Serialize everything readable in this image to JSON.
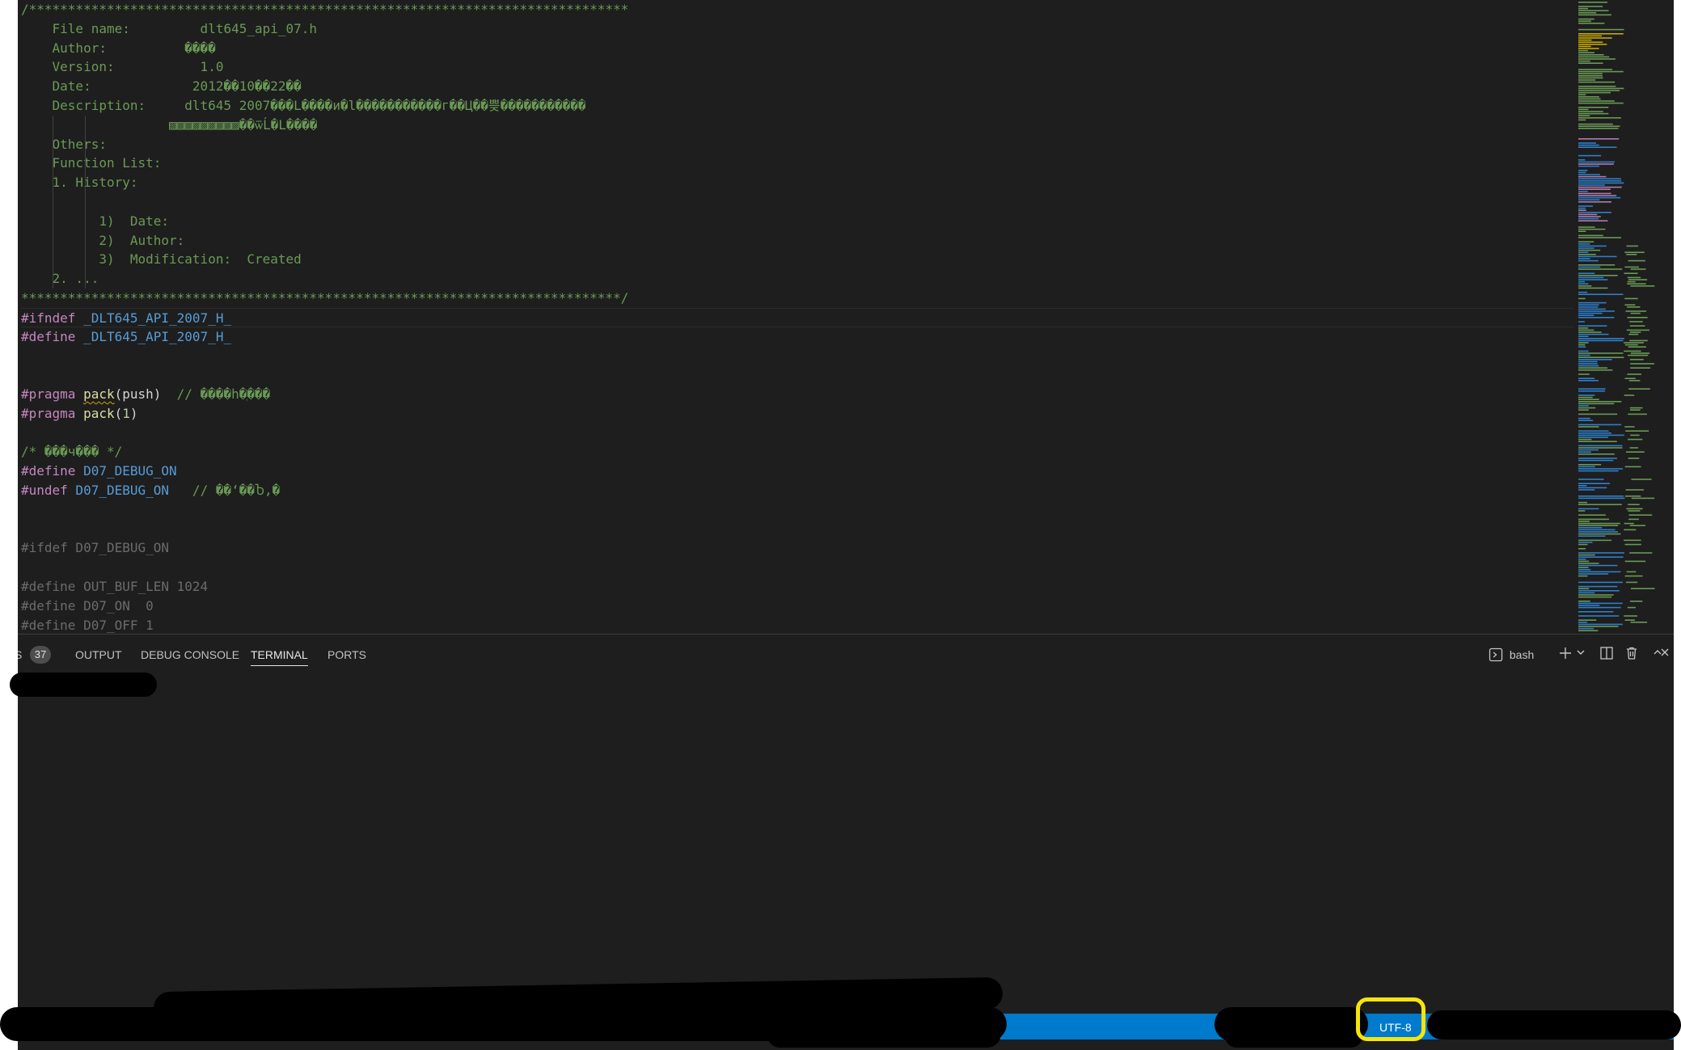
{
  "editor": {
    "lines": [
      {
        "parts": [
          {
            "cls": "c",
            "text": "/*****************************************************************************"
          }
        ]
      },
      {
        "parts": [
          {
            "cls": "c",
            "text": "    File name:         dlt645_api_07.h"
          }
        ]
      },
      {
        "parts": [
          {
            "cls": "c",
            "text": "    Author:          ����"
          }
        ]
      },
      {
        "parts": [
          {
            "cls": "c",
            "text": "    Version:           1.0"
          }
        ]
      },
      {
        "parts": [
          {
            "cls": "c",
            "text": "    Date:             2012��10��22��"
          }
        ]
      },
      {
        "parts": [
          {
            "cls": "c",
            "text": "    Description:     dlt645 2007���L����и�l�����������г��Ц��쁮�����������"
          }
        ]
      },
      {
        "parts": [
          {
            "cls": "c",
            "text": "                   ▨▨▨▨▨▨▨▨▨��ѿĹ�L����"
          }
        ]
      },
      {
        "parts": [
          {
            "cls": "c",
            "text": "    Others:"
          }
        ]
      },
      {
        "parts": [
          {
            "cls": "c",
            "text": "    Function List:"
          }
        ]
      },
      {
        "parts": [
          {
            "cls": "c",
            "text": "    1. History:"
          }
        ]
      },
      {
        "parts": [
          {
            "cls": "c",
            "text": ""
          }
        ]
      },
      {
        "parts": [
          {
            "cls": "c",
            "text": "          1)  Date:"
          }
        ]
      },
      {
        "parts": [
          {
            "cls": "c",
            "text": "          2)  Author:"
          }
        ]
      },
      {
        "parts": [
          {
            "cls": "c",
            "text": "          3)  Modification:  Created"
          }
        ]
      },
      {
        "parts": [
          {
            "cls": "c",
            "text": "    2. ..."
          }
        ]
      },
      {
        "parts": [
          {
            "cls": "c",
            "text": "*****************************************************************************/"
          }
        ]
      },
      {
        "current": true,
        "parts": [
          {
            "cls": "pp",
            "text": "#ifndef"
          },
          {
            "cls": "mac",
            "text": " _DLT645_API_2007_H_"
          }
        ]
      },
      {
        "parts": [
          {
            "cls": "pp",
            "text": "#define"
          },
          {
            "cls": "mac",
            "text": " _DLT645_API_2007_H_"
          }
        ]
      },
      {
        "parts": [
          {
            "cls": "pn",
            "text": ""
          }
        ]
      },
      {
        "parts": [
          {
            "cls": "pn",
            "text": ""
          }
        ]
      },
      {
        "parts": [
          {
            "cls": "pp",
            "text": "#pragma"
          },
          {
            "cls": "pn",
            "text": " "
          },
          {
            "cls": "fn squig",
            "text": "pack"
          },
          {
            "cls": "pn",
            "text": "(push)"
          },
          {
            "cls": "c",
            "text": "  // ����һ�ֽ���"
          }
        ]
      },
      {
        "parts": [
          {
            "cls": "pp",
            "text": "#pragma"
          },
          {
            "cls": "pn",
            "text": " "
          },
          {
            "cls": "fn",
            "text": "pack"
          },
          {
            "cls": "pn",
            "text": "("
          },
          {
            "cls": "num",
            "text": "1"
          },
          {
            "cls": "pn",
            "text": ")"
          }
        ]
      },
      {
        "parts": [
          {
            "cls": "pn",
            "text": ""
          }
        ]
      },
      {
        "parts": [
          {
            "cls": "c",
            "text": "/* ���ч��� */"
          }
        ]
      },
      {
        "parts": [
          {
            "cls": "pp",
            "text": "#define"
          },
          {
            "cls": "mac",
            "text": " D07_DEBUG_ON"
          }
        ]
      },
      {
        "parts": [
          {
            "cls": "pp",
            "text": "#undef"
          },
          {
            "cls": "mac",
            "text": " D07_DEBUG_ON"
          },
          {
            "cls": "c",
            "text": "   // ��ʻ��Ⴆ,�"
          }
        ]
      },
      {
        "parts": [
          {
            "cls": "pn",
            "text": ""
          }
        ]
      },
      {
        "parts": [
          {
            "cls": "pn",
            "text": ""
          }
        ]
      },
      {
        "parts": [
          {
            "cls": "dim",
            "text": "#ifdef D07_DEBUG_ON"
          }
        ]
      },
      {
        "parts": [
          {
            "cls": "pn",
            "text": ""
          }
        ]
      },
      {
        "parts": [
          {
            "cls": "dim",
            "text": "#define OUT_BUF_LEN 1024"
          }
        ]
      },
      {
        "parts": [
          {
            "cls": "dim",
            "text": "#define D07_ON  0"
          }
        ]
      },
      {
        "parts": [
          {
            "cls": "dim",
            "text": "#define D07_OFF 1"
          }
        ]
      }
    ]
  },
  "panel": {
    "tab_cut_label": "S",
    "problems_count": "37",
    "tabs": [
      "OUTPUT",
      "DEBUG CONSOLE",
      "TERMINAL",
      "PORTS"
    ],
    "active_tab": "TERMINAL",
    "terminal_profile": "bash"
  },
  "status_bar": {
    "encoding": "UTF-8",
    "color": "#007acc"
  },
  "icons": [
    "terminal-icon",
    "plus-icon",
    "chevron-down-icon",
    "split-icon",
    "trash-icon",
    "chevron-up-icon",
    "close-icon"
  ]
}
